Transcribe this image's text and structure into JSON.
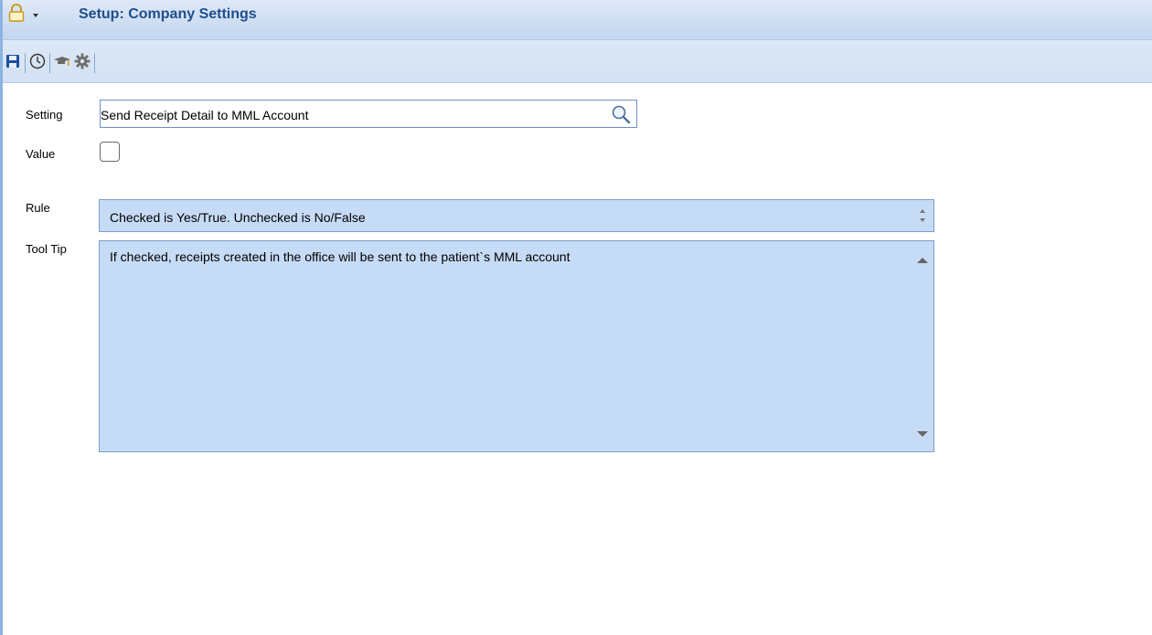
{
  "window": {
    "title": "Setup: Company Settings"
  },
  "icons": {
    "lock": "lock-icon",
    "dropdown": "caret-down-icon",
    "save": "save-icon",
    "history": "clock-icon",
    "graduation": "graduation-cap-icon",
    "settings": "gear-icon",
    "search": "magnifier-icon"
  },
  "form": {
    "setting_label": "Setting",
    "setting_value": "Send Receipt Detail to MML Account",
    "value_label": "Value",
    "value_checked": false,
    "rule_label": "Rule",
    "rule_text": "Checked is Yes/True. Unchecked is No/False",
    "tooltip_label": "Tool Tip",
    "tooltip_text": "If checked, receipts created in the office will be sent to the patient`s MML account"
  },
  "colors": {
    "title": "#1f4e8c",
    "field_fill": "#c6dbf5",
    "border_accent": "#8db3e2"
  }
}
